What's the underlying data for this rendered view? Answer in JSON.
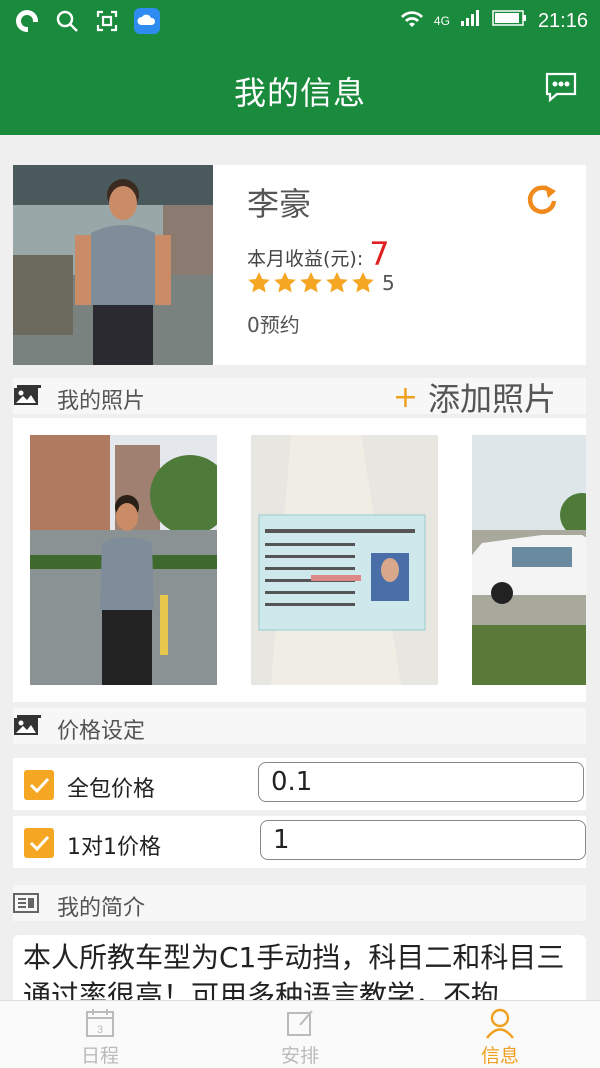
{
  "statusbar": {
    "time": "21:16",
    "network": "4G"
  },
  "header": {
    "title": "我的信息"
  },
  "profile": {
    "name": "李豪",
    "income_label": "本月收益(元):",
    "income_value": "7",
    "rating": "5",
    "appointments": "0预约"
  },
  "photos_section": {
    "label": "我的照片",
    "add_label": "添加照片"
  },
  "price_section": {
    "label": "价格设定",
    "rows": [
      {
        "label": "全包价格",
        "value": "0.1",
        "checked": true
      },
      {
        "label": "1对1价格",
        "value": "1",
        "checked": true
      }
    ]
  },
  "intro_section": {
    "label": "我的简介",
    "text": "本人所教车型为C1手动挡，科目二和科目三通过率很高！可用多种语言教学，不拘"
  },
  "bottom_nav": {
    "tabs": [
      {
        "label": "日程",
        "icon": "calendar-icon",
        "active": false
      },
      {
        "label": "安排",
        "icon": "edit-icon",
        "active": false
      },
      {
        "label": "信息",
        "icon": "person-icon",
        "active": true
      }
    ]
  },
  "colors": {
    "primary": "#1a8a3c",
    "accent": "#f0a020",
    "income": "#e02020"
  }
}
